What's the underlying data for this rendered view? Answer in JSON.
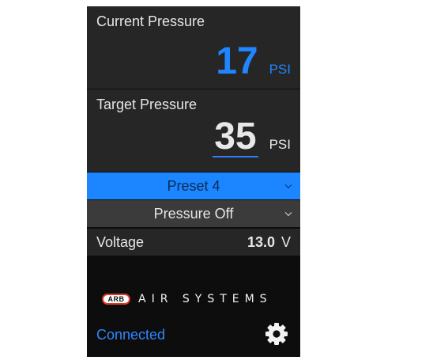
{
  "current": {
    "label": "Current Pressure",
    "value": "17",
    "unit": "PSI"
  },
  "target": {
    "label": "Target Pressure",
    "value": "35",
    "unit": "PSI"
  },
  "preset_select": {
    "value": "Preset 4"
  },
  "mode_select": {
    "value": "Pressure Off"
  },
  "voltage": {
    "label": "Voltage",
    "value": "13.0",
    "unit": "V"
  },
  "brand": {
    "logo_text": "ARB",
    "text": "AIR SYSTEMS"
  },
  "connection": {
    "status": "Connected"
  },
  "icons": {
    "settings": "gear-icon",
    "dropdown": "chevron-down-icon"
  },
  "colors": {
    "accent": "#1f86ff",
    "preset_bg": "#1b86ff",
    "background": "#0d0d0d",
    "panel": "#262626",
    "logo_red": "#d93a2b"
  }
}
